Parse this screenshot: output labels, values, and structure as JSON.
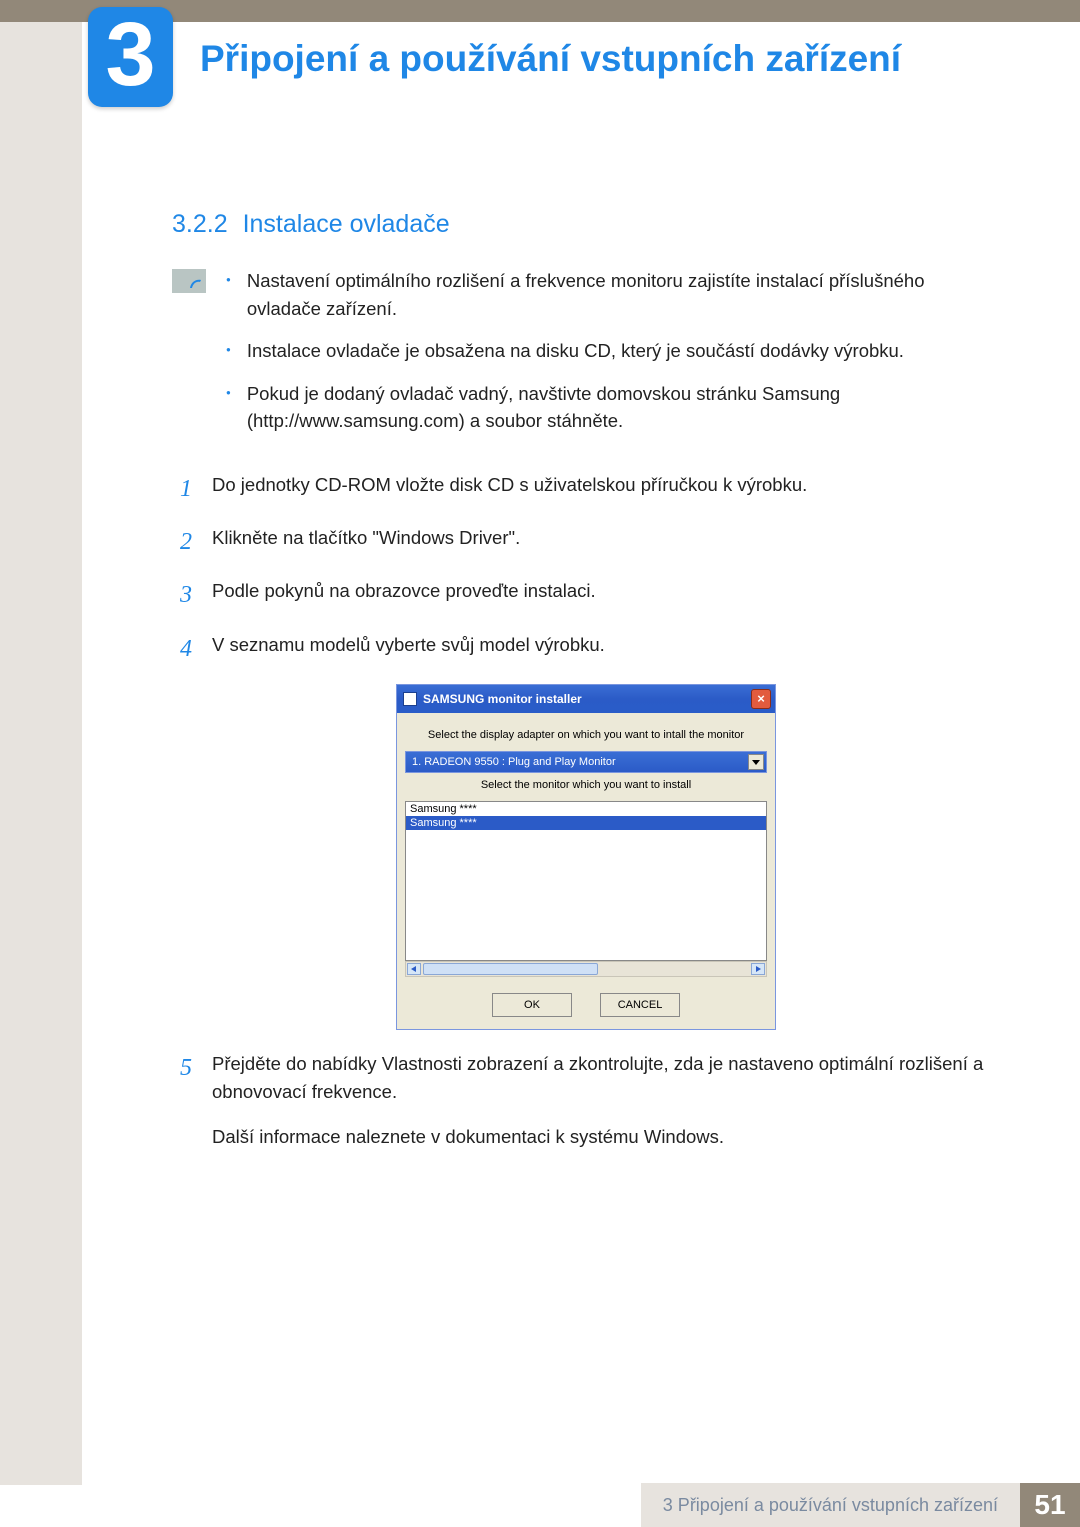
{
  "chapter_number": "3",
  "page_title": "Připojení a používání vstupních zařízení",
  "section": {
    "num": "3.2.2",
    "title": "Instalace ovladače"
  },
  "note_bullets": [
    "Nastavení optimálního rozlišení a frekvence monitoru zajistíte instalací příslušného ovladače zařízení.",
    "Instalace ovladače je obsažena na disku CD, který je součástí dodávky výrobku.",
    "Pokud je dodaný ovladač vadný, navštivte domovskou stránku Samsung (http://www.samsung.com) a soubor stáhněte."
  ],
  "steps": [
    {
      "n": "1",
      "t": "Do jednotky CD-ROM vložte disk CD s uživatelskou příručkou k výrobku."
    },
    {
      "n": "2",
      "t": "Klikněte na tlačítko \"Windows Driver\"."
    },
    {
      "n": "3",
      "t": "Podle pokynů na obrazovce proveďte instalaci."
    },
    {
      "n": "4",
      "t": "V seznamu modelů vyberte svůj model výrobku."
    },
    {
      "n": "5",
      "t": "Přejděte do nabídky Vlastnosti zobrazení a zkontrolujte, zda je nastaveno optimální rozlišení a obnovovací frekvence."
    }
  ],
  "post_step5_line": "Další informace naleznete v dokumentaci k systému Windows.",
  "installer": {
    "title": "SAMSUNG monitor installer",
    "label1": "Select the display adapter on which you want to intall the monitor",
    "dropdown_value": "1. RADEON 9550 : Plug and Play Monitor",
    "label2": "Select the monitor which you want to install",
    "list_items": [
      "Samsung ****",
      "Samsung ****"
    ],
    "ok": "OK",
    "cancel": "CANCEL"
  },
  "footer": {
    "label": "3 Připojení a používání vstupních zařízení",
    "page": "51"
  }
}
